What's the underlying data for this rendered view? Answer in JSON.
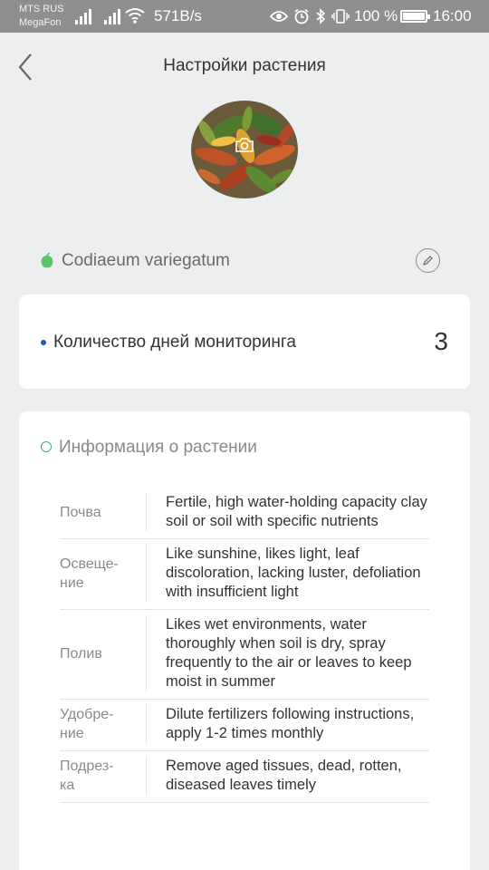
{
  "status_bar": {
    "carrier_1": "MTS RUS",
    "carrier_2": "MegaFon",
    "network_speed": "571B/s",
    "battery_percent": "100 %",
    "battery_level": 1.0,
    "time": "16:00",
    "icons": [
      "signal-icon",
      "signal-icon",
      "wifi-icon",
      "eye-icon",
      "alarm-icon",
      "bluetooth-icon",
      "vibrate-icon",
      "battery-icon"
    ]
  },
  "header": {
    "title": "Настройки растения",
    "back_icon": "chevron-left-icon"
  },
  "avatar": {
    "camera_icon": "camera-icon"
  },
  "plant": {
    "name": "Codiaeum variegatum",
    "leaf_icon": "leaf-icon",
    "edit_icon": "pencil-icon"
  },
  "monitoring": {
    "label": "Количество дней мониторинга",
    "value": "3"
  },
  "info": {
    "title": "Информация о растении",
    "rows": [
      {
        "label": "Почва",
        "value": "Fertile, high water-holding capacity clay soil or soil with specific nutrients"
      },
      {
        "label": "Освеще-\nние",
        "value": "Like sunshine, likes light, leaf discoloration, lacking luster, defoliation with insufficient light"
      },
      {
        "label": "Полив",
        "value": "Likes wet environments, water thoroughly when soil is dry, spray frequently to the air or leaves to keep moist in summer"
      },
      {
        "label": "Удобре-\nние",
        "value": "Dilute fertilizers following instructions, apply 1-2 times monthly"
      },
      {
        "label": "Подрез-\nка",
        "value": "Remove aged tissues, dead, rotten, diseased leaves timely"
      }
    ]
  },
  "colors": {
    "status_bar": "#8f8f8f",
    "background": "#eceeef",
    "accent_green": "#34b38a",
    "leaf_green": "#5cc46a",
    "dot_blue": "#1f5fb3"
  }
}
